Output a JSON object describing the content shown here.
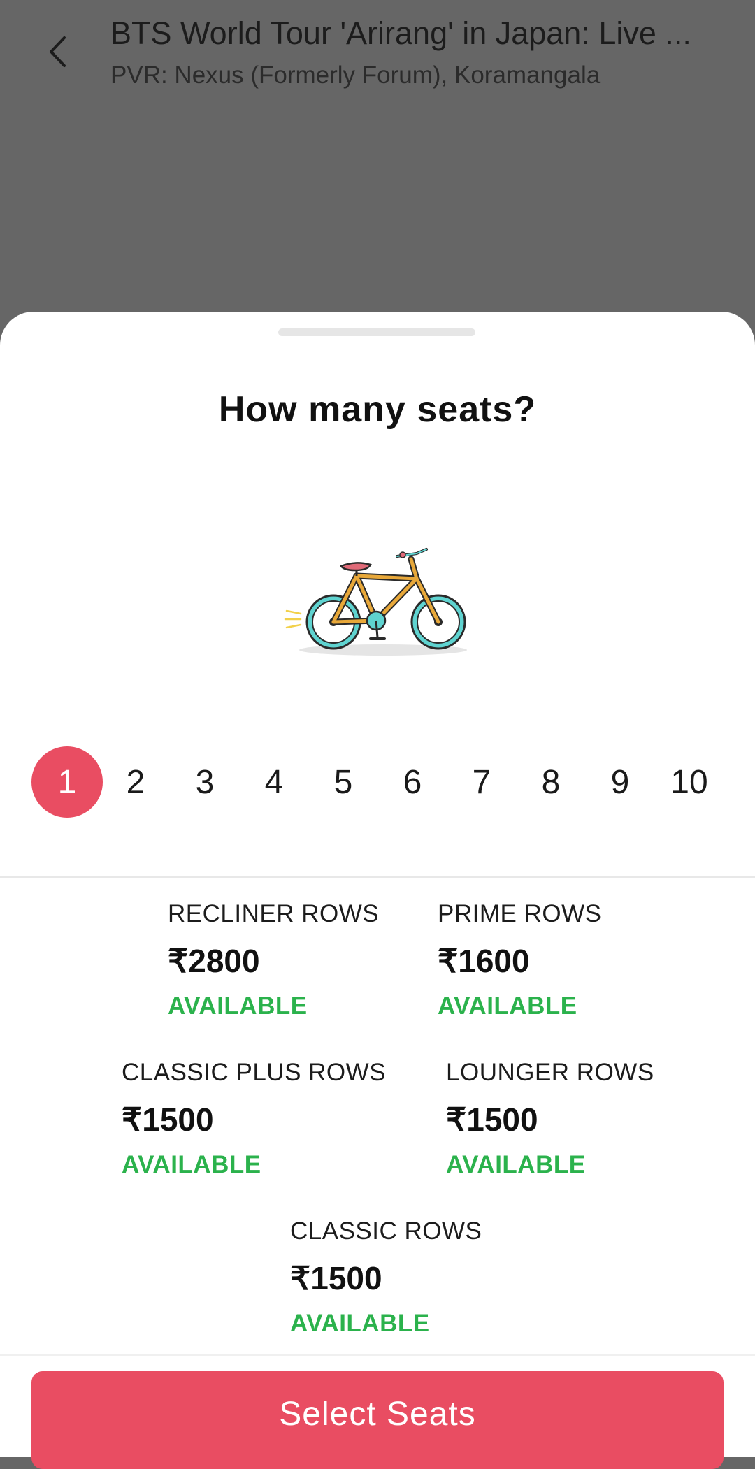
{
  "header": {
    "title": "BTS World Tour 'Arirang' in Japan: Live ...",
    "subtitle": "PVR: Nexus (Formerly Forum), Koramangala",
    "back_icon": "chevron-left-icon"
  },
  "sheet": {
    "title": "How many seats?",
    "illustration": "bicycle-icon",
    "seat_options": [
      "1",
      "2",
      "3",
      "4",
      "5",
      "6",
      "7",
      "8",
      "9",
      "10"
    ],
    "selected_seat": "1",
    "categories": [
      {
        "name": "RECLINER ROWS",
        "price": "₹2800",
        "status": "AVAILABLE"
      },
      {
        "name": "PRIME ROWS",
        "price": "₹1600",
        "status": "AVAILABLE"
      },
      {
        "name": "CLASSIC PLUS ROWS",
        "price": "₹1500",
        "status": "AVAILABLE"
      },
      {
        "name": "LOUNGER ROWS",
        "price": "₹1500",
        "status": "AVAILABLE"
      },
      {
        "name": "CLASSIC ROWS",
        "price": "₹1500",
        "status": "AVAILABLE"
      }
    ],
    "cta_label": "Select Seats"
  },
  "colors": {
    "accent": "#e94d62",
    "available": "#2bb24c",
    "overlay": "#666666"
  }
}
